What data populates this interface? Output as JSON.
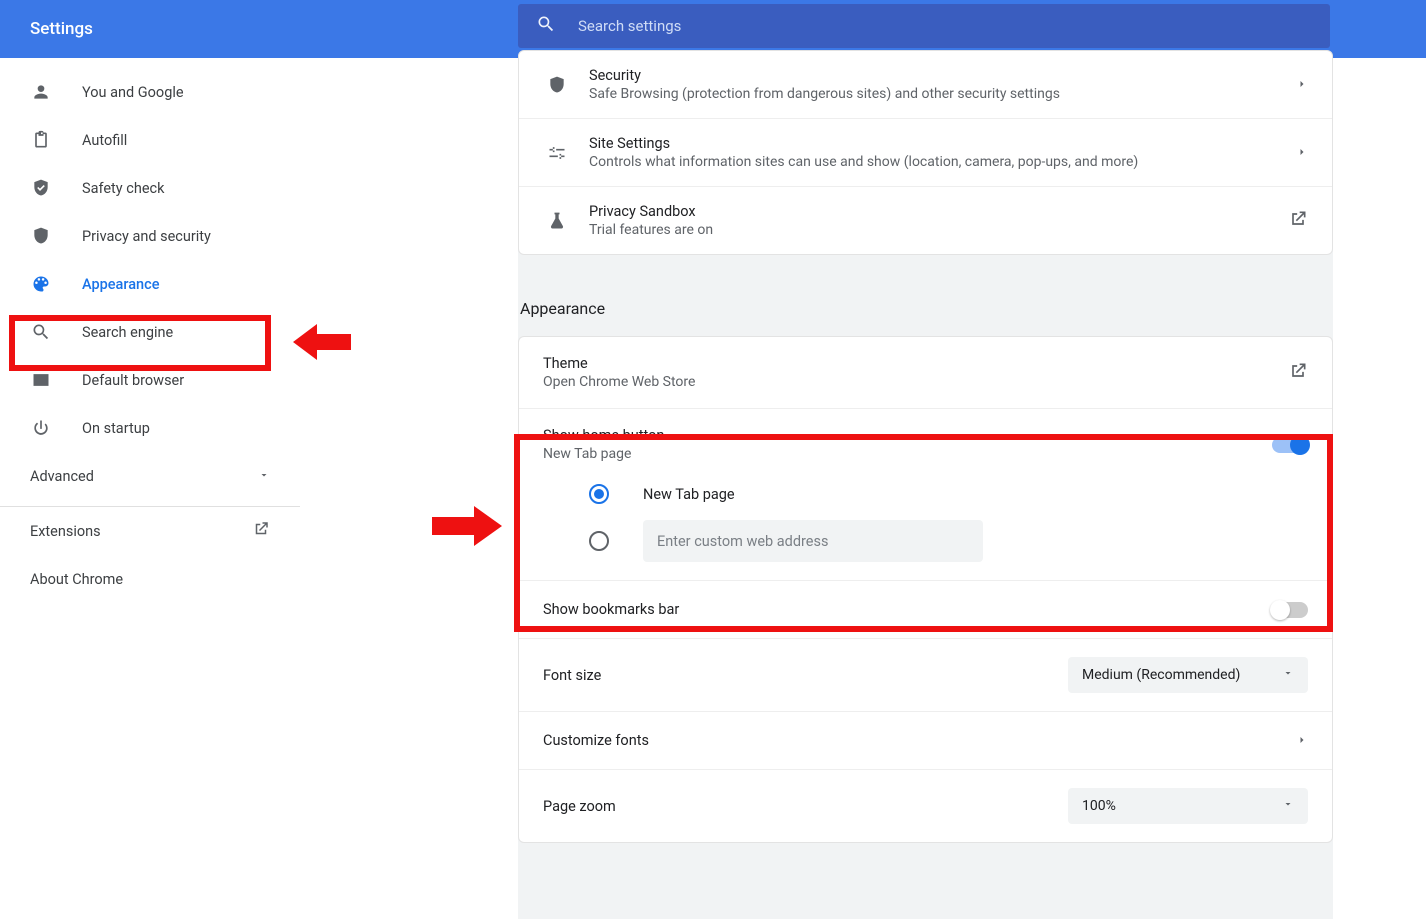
{
  "header": {
    "title": "Settings"
  },
  "search": {
    "placeholder": "Search settings"
  },
  "sidebar": {
    "items": [
      {
        "label": "You and Google"
      },
      {
        "label": "Autofill"
      },
      {
        "label": "Safety check"
      },
      {
        "label": "Privacy and security"
      },
      {
        "label": "Appearance"
      },
      {
        "label": "Search engine"
      },
      {
        "label": "Default browser"
      },
      {
        "label": "On startup"
      }
    ],
    "advanced": "Advanced",
    "extensions": "Extensions",
    "about": "About Chrome"
  },
  "privacy_card": {
    "security": {
      "title": "Security",
      "sub": "Safe Browsing (protection from dangerous sites) and other security settings"
    },
    "site": {
      "title": "Site Settings",
      "sub": "Controls what information sites can use and show (location, camera, pop-ups, and more)"
    },
    "sandbox": {
      "title": "Privacy Sandbox",
      "sub": "Trial features are on"
    }
  },
  "appearance": {
    "heading": "Appearance",
    "theme": {
      "title": "Theme",
      "sub": "Open Chrome Web Store"
    },
    "home": {
      "title": "Show home button",
      "sub": "New Tab page",
      "radio1": "New Tab page",
      "custom_placeholder": "Enter custom web address"
    },
    "bookmarks": "Show bookmarks bar",
    "fontsize_label": "Font size",
    "fontsize_value": "Medium (Recommended)",
    "customize_fonts": "Customize fonts",
    "zoom_label": "Page zoom",
    "zoom_value": "100%"
  }
}
